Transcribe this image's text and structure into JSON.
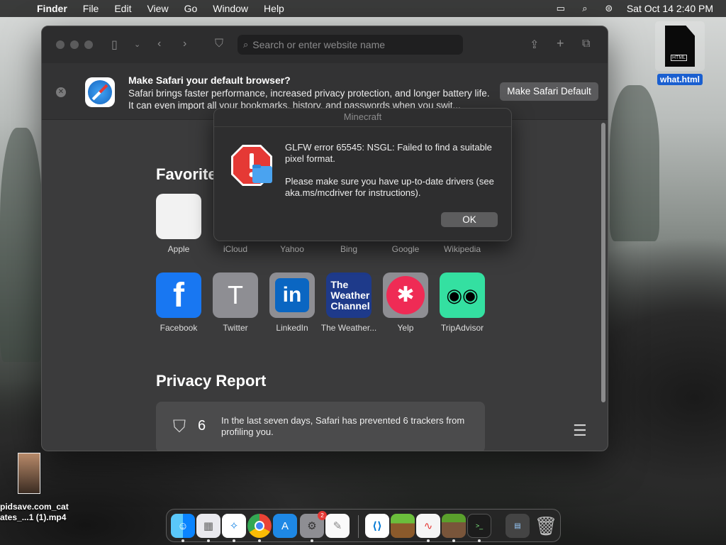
{
  "menubar": {
    "app_name": "Finder",
    "items": [
      "File",
      "Edit",
      "View",
      "Go",
      "Window",
      "Help"
    ],
    "datetime": "Sat Oct 14  2:40 PM"
  },
  "safari": {
    "url_placeholder": "Search or enter website name",
    "banner": {
      "title": "Make Safari your default browser?",
      "text": "Safari brings faster performance, increased privacy protection, and longer battery life. It can even import all your bookmarks, history, and passwords when you swit...",
      "button": "Make Safari Default"
    },
    "favorites_title": "Favorite",
    "favorites_row1": [
      {
        "label": "Apple"
      },
      {
        "label": "iCloud"
      },
      {
        "label": "Yahoo"
      },
      {
        "label": "Bing"
      },
      {
        "label": "Google"
      },
      {
        "label": "Wikipedia"
      }
    ],
    "favorites_row2": [
      {
        "label": "Facebook",
        "glyph": "f",
        "bg": "#1877f2"
      },
      {
        "label": "Twitter",
        "glyph": "T",
        "bg": "#8e8e93"
      },
      {
        "label": "LinkedIn",
        "glyph": "in",
        "bg": "#8e8e93"
      },
      {
        "label": "The Weather...",
        "glyph": "The Weather Channel",
        "bg": "#1e3a8a"
      },
      {
        "label": "Yelp",
        "glyph": "✱",
        "bg": "#8e8e93"
      },
      {
        "label": "TripAdvisor",
        "glyph": "◉◉",
        "bg": "#34e0a1"
      }
    ],
    "privacy": {
      "title": "Privacy Report",
      "count": "6",
      "text": "In the last seven days, Safari has prevented 6 trackers from profiling you."
    }
  },
  "dialog": {
    "title": "Minecraft",
    "message1": "GLFW error 65545: NSGL: Failed to find a suitable pixel format.",
    "message2": "Please make sure you have up-to-date drivers (see aka.ms/mcdriver for instructions).",
    "ok": "OK"
  },
  "desktop": {
    "file_name": "what.html",
    "file_badge": "HTML",
    "video_name_line1": "pidsave.com_cat",
    "video_name_line2": "ates_...1 (1).mp4"
  },
  "dock": {
    "settings_badge": "2"
  }
}
